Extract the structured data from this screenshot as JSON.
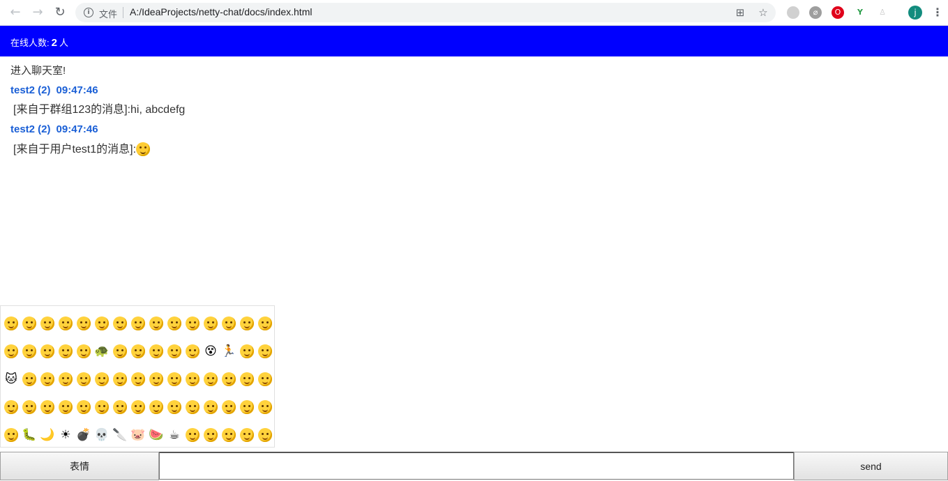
{
  "browser": {
    "url_scheme_label": "文件",
    "url": "A:/IdeaProjects/netty-chat/docs/index.html",
    "avatar_letter": "j",
    "back_icon": "back-arrow-icon",
    "forward_icon": "forward-arrow-icon",
    "reload_icon": "reload-icon"
  },
  "header": {
    "online_label": "在线人数:",
    "online_count": "2",
    "online_unit": "人",
    "background_color": "#0000ff"
  },
  "messages": {
    "system": "进入聊天室!",
    "items": [
      {
        "sender": "test2 (2)",
        "time": "09:47:46",
        "body": "[来自于群组123的消息]:hi, abcdefg"
      },
      {
        "sender": "test2 (2)",
        "time": "09:47:46",
        "body": "[来自于用户test1的消息]:",
        "emoji": "thinking-emoji"
      }
    ]
  },
  "emoji_panel": {
    "rows": 5,
    "columns": 15,
    "special": {
      "20": "🐢",
      "26": "😵",
      "27": "🏃",
      "30": "🐱",
      "61": "🐛",
      "62": "🌙",
      "63": "☀",
      "64": "💣",
      "65": "💀",
      "66": "🔪",
      "67": "🐷",
      "68": "🍉",
      "69": "☕",
      "75": "🍚",
      "76": "❤",
      "77": "👍",
      "78": "👎",
      "79": "🤝",
      "80": "✌",
      "81": "✋",
      "82": "👌",
      "83": "👌",
      "84": "👆",
      "85": "🌹",
      "86": "🥀",
      "87": "👄",
      "88": "💑",
      "89": "🐧"
    }
  },
  "footer": {
    "emoji_button": "表情",
    "input_value": "",
    "send_button": "send"
  }
}
